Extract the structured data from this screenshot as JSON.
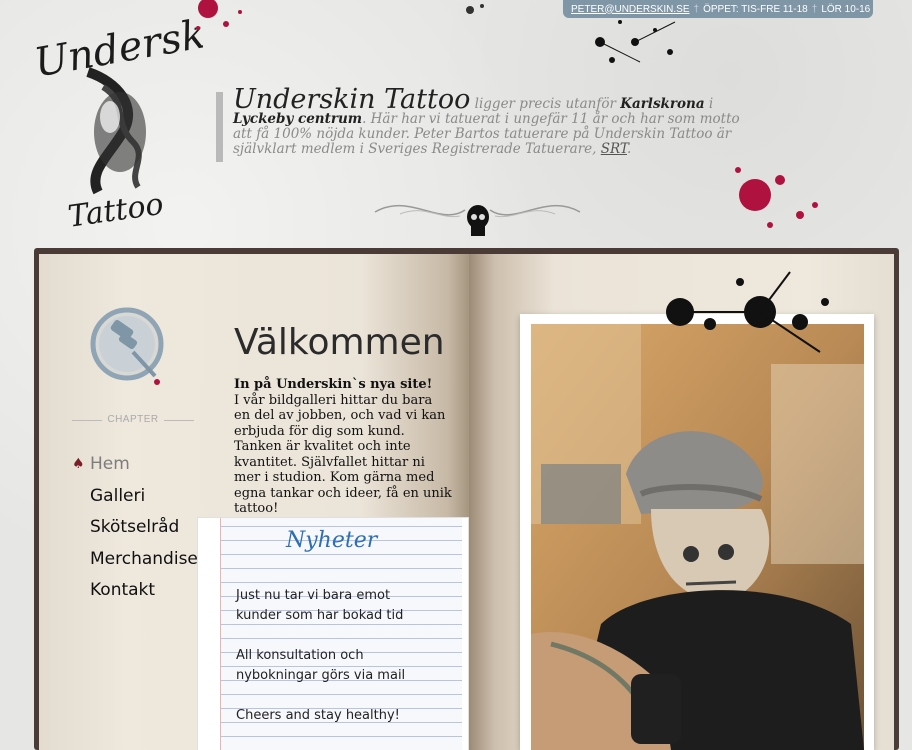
{
  "topbar": {
    "email": "PETER@UNDERSKIN.SE",
    "sep": "†",
    "hours_weekday": "ÖPPET: TIS-FRE 11-18",
    "hours_saturday": "LÖR 10-16"
  },
  "intro": {
    "brand": "Underskin Tattoo",
    "text_1": " ligger precis utanför ",
    "place_1": "Karlskrona",
    "text_2": " i ",
    "place_2": "Lyckeby centrum",
    "text_3": ". Här har vi tatuerat i ungefär 11 år och har som motto att få 100% nöjda kunder. Peter Bartos tatuerare på Underskin Tattoo är självklart medlem i Sveriges Registrerade Tatuerare, ",
    "srt": "SRT",
    "text_4": "."
  },
  "sidebar": {
    "chapter_label": "CHAPTER",
    "items": [
      {
        "label": "Hem",
        "active": true
      },
      {
        "label": "Galleri",
        "active": false
      },
      {
        "label": "Skötselråd",
        "active": false
      },
      {
        "label": "Merchandise",
        "active": false
      },
      {
        "label": "Kontakt",
        "active": false
      }
    ]
  },
  "welcome": {
    "title": "Välkommen",
    "heading": "In på Underskin`s nya site!",
    "body": "I vår bildgalleri hittar du bara en del av jobben, och vad vi kan erbjuda för dig som kund. Tanken är kvalitet och inte kvantitet. Självfallet hittar ni mer i studion. Kom gärna med egna tankar och ideer, få en unik tattoo!"
  },
  "news": {
    "title": "Nyheter",
    "line_1": "Just nu tar vi bara emot",
    "line_2": "kunder som har bokad tid",
    "line_3": "All konsultation och",
    "line_4": "nybokningar görs via mail",
    "line_5": "Cheers and stay healthy!"
  },
  "colors": {
    "topbar": "#7f96a6",
    "accent_red": "#b0123f",
    "book_frame": "#4a3b36"
  }
}
